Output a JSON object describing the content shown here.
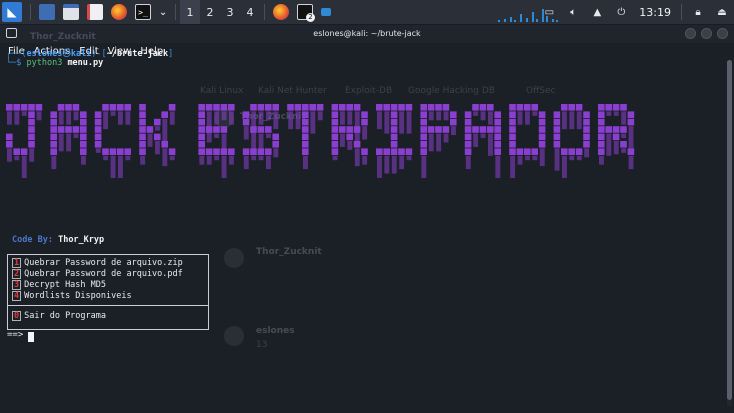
{
  "taskbar": {
    "workspaces": [
      "1",
      "2",
      "3",
      "4"
    ],
    "clock": "13:19",
    "badge": "2"
  },
  "window": {
    "title": "eslones@kali: ~/brute-jack",
    "menu": [
      "File",
      "Actions",
      "Edit",
      "View",
      "Help"
    ]
  },
  "prompt": {
    "user": "eslones",
    "host": "kali",
    "path": "~/brute-jack",
    "command": "python3",
    "argument": "menu.py"
  },
  "banner": {
    "text": "JACK ESTRIPADOR",
    "color": "#8a3fd0"
  },
  "credit": {
    "label": "Code By:",
    "author": "Thor_Kryp"
  },
  "menu_options": [
    {
      "num": "1",
      "label": "Quebrar Password de arquivo.zip"
    },
    {
      "num": "2",
      "label": "Quebrar Password de arquivo.pdf"
    },
    {
      "num": "3",
      "label": "Decrypt Hash MD5"
    },
    {
      "num": "4",
      "label": "Wordlists Disponiveis"
    },
    {
      "num": "0",
      "label": "Sair do Programa"
    }
  ],
  "input_prompt": "==>",
  "background_app": {
    "channel": "Thor_Zucknit",
    "items": [
      "Kali Linux",
      "Kali Net Hunter",
      "Exploit-DB",
      "Google Hacking DB",
      "OffSec"
    ],
    "user2": "eslones",
    "msg": "13"
  },
  "colors": {
    "accent": "#8a3fd0",
    "prompt_blue": "#3d8fe0",
    "option_red": "#e03b3b"
  }
}
